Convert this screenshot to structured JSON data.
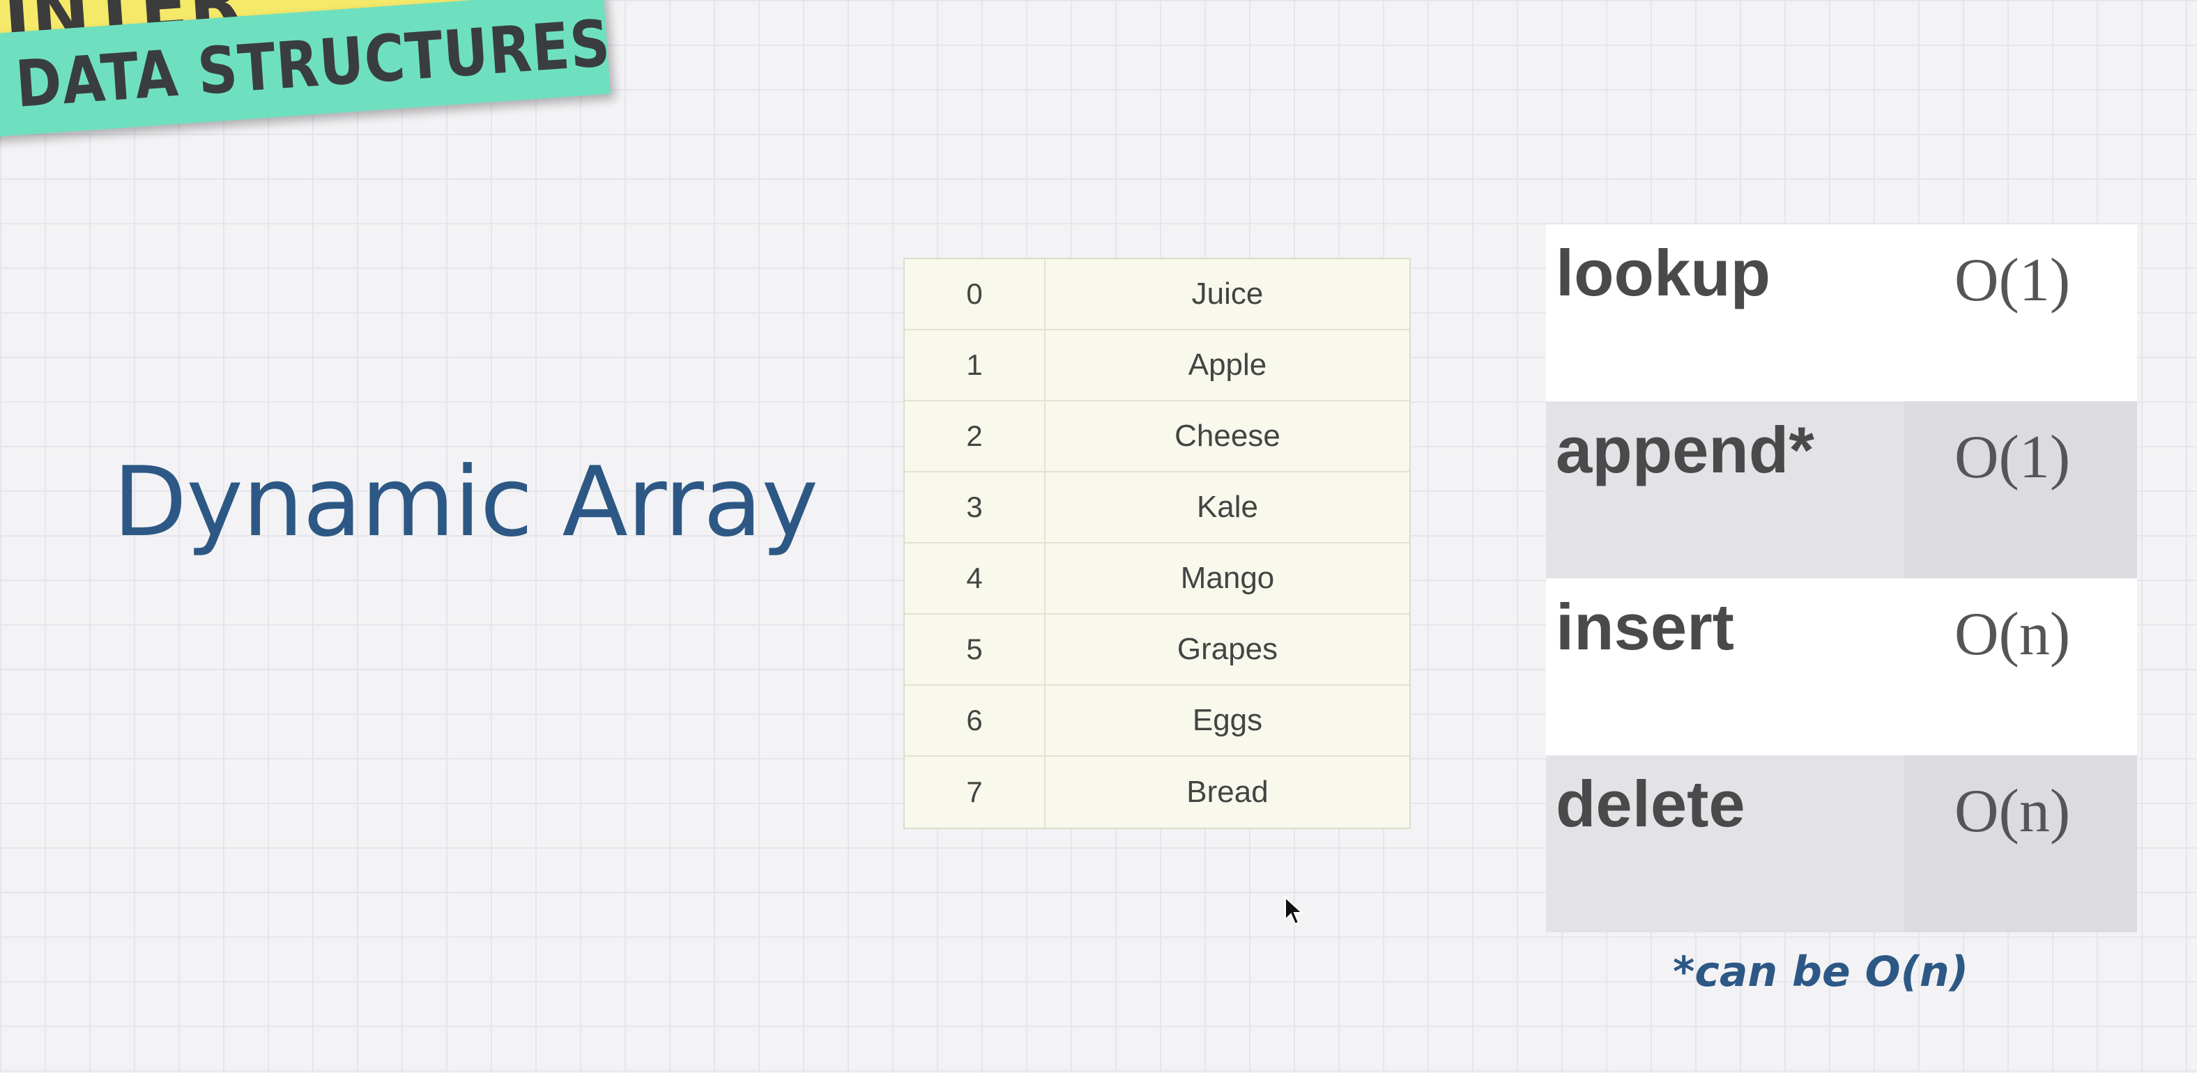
{
  "banner": {
    "top_text": "INTER",
    "bottom_text": "DATA STRUCTURES"
  },
  "title": "Dynamic Array",
  "array": [
    {
      "index": "0",
      "value": "Juice"
    },
    {
      "index": "1",
      "value": "Apple"
    },
    {
      "index": "2",
      "value": "Cheese"
    },
    {
      "index": "3",
      "value": "Kale"
    },
    {
      "index": "4",
      "value": "Mango"
    },
    {
      "index": "5",
      "value": "Grapes"
    },
    {
      "index": "6",
      "value": "Eggs"
    },
    {
      "index": "7",
      "value": "Bread"
    }
  ],
  "operations": [
    {
      "name": "lookup",
      "complexity": "O(1)"
    },
    {
      "name": "append*",
      "complexity": "O(1)"
    },
    {
      "name": "insert",
      "complexity": "O(n)"
    },
    {
      "name": "delete",
      "complexity": "O(n)"
    }
  ],
  "footnote": "*can be O(n)",
  "colors": {
    "title": "#2d5885",
    "banner_yellow": "#f5e96a",
    "banner_teal": "#6ee0c0",
    "table_bg": "#f8f8ec",
    "row_gray": "#e3e2e6"
  },
  "icons": {
    "cursor": "mouse-pointer-icon"
  }
}
